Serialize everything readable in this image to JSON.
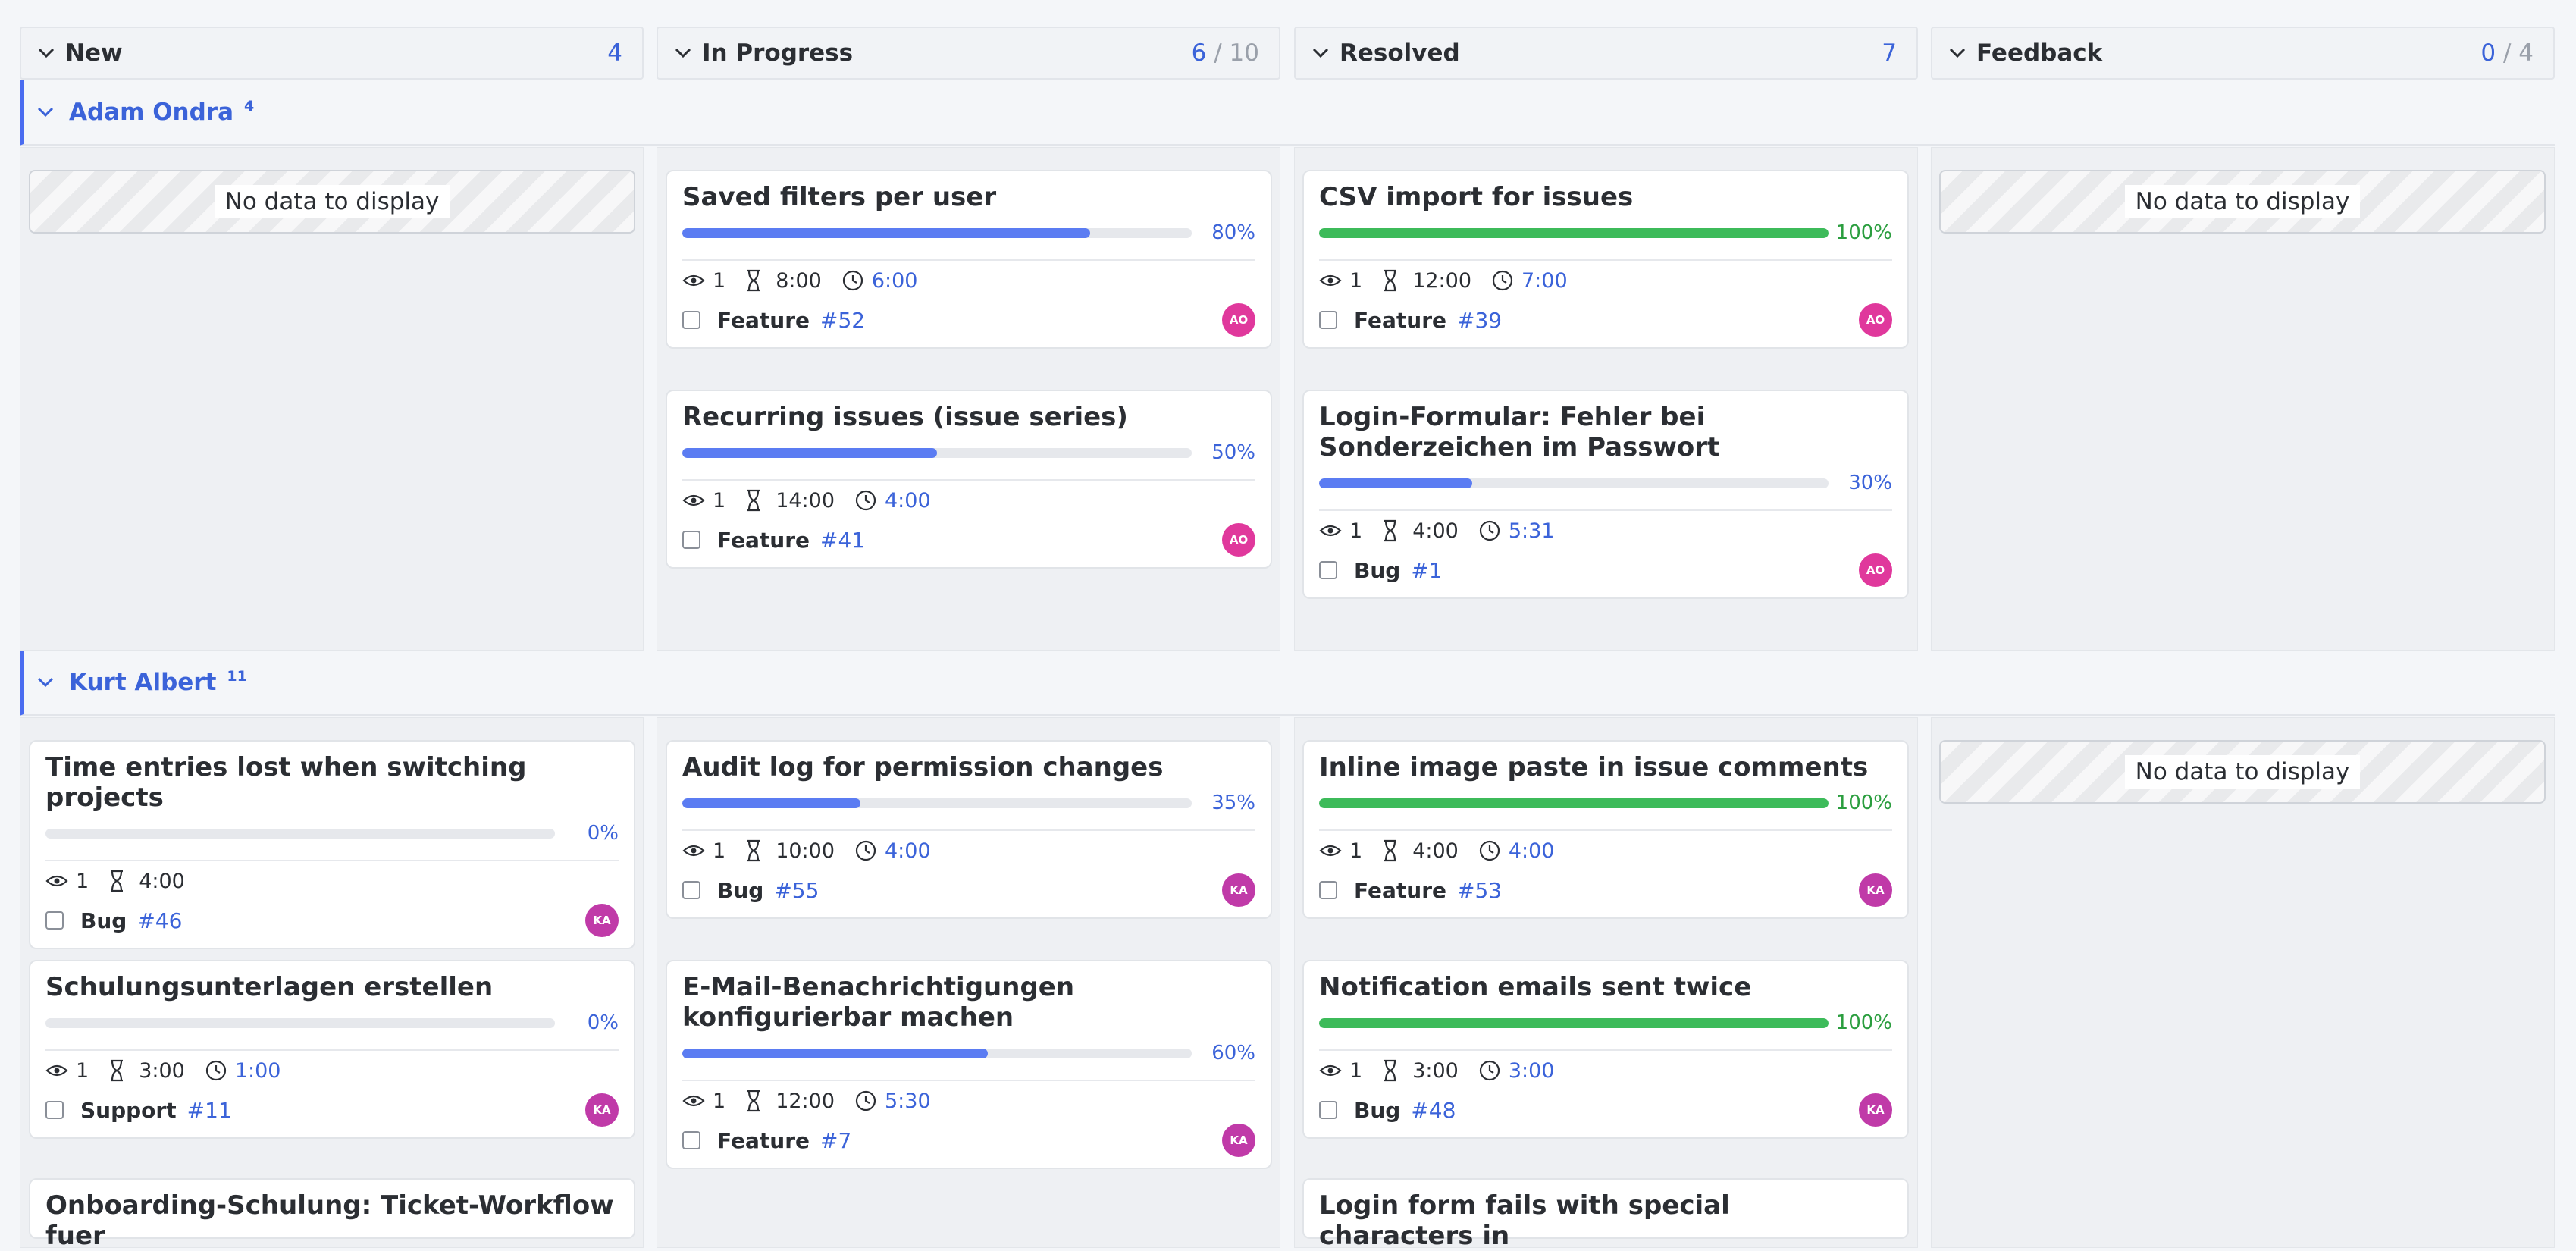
{
  "colors": {
    "accent": "#3b63d9",
    "progress_blue": "#5b7cf2",
    "progress_green": "#3dbb5a",
    "avatar_ao": "#e0389c",
    "avatar_ka": "#c03aa8"
  },
  "columns": [
    {
      "title": "New",
      "count": "4",
      "limit": ""
    },
    {
      "title": "In Progress",
      "count": "6",
      "limit": "10"
    },
    {
      "title": "Resolved",
      "count": "7",
      "limit": ""
    },
    {
      "title": "Feedback",
      "count": "0",
      "limit": "4"
    }
  ],
  "limit_separator": "/",
  "empty_text": "No data to display",
  "groups": [
    {
      "name": "Adam Ondra",
      "count": "4",
      "cards": {
        "in_progress": [
          {
            "subject": "Saved filters per user",
            "percent": 80,
            "percent_label": "80%",
            "watchers": "1",
            "estimated": "8:00",
            "spent": "6:00",
            "tracker": "Feature",
            "number": "#52",
            "avatar": "AO"
          },
          {
            "subject": "Recurring issues (issue series)",
            "percent": 50,
            "percent_label": "50%",
            "watchers": "1",
            "estimated": "14:00",
            "spent": "4:00",
            "tracker": "Feature",
            "number": "#41",
            "avatar": "AO"
          }
        ],
        "resolved": [
          {
            "subject": "CSV import for issues",
            "percent": 100,
            "percent_label": "100%",
            "watchers": "1",
            "estimated": "12:00",
            "spent": "7:00",
            "tracker": "Feature",
            "number": "#39",
            "avatar": "AO"
          },
          {
            "subject": "Login-Formular: Fehler bei Sonderzeichen im Passwort",
            "percent": 30,
            "percent_label": "30%",
            "watchers": "1",
            "estimated": "4:00",
            "spent": "5:31",
            "tracker": "Bug",
            "number": "#1",
            "avatar": "AO"
          }
        ]
      }
    },
    {
      "name": "Kurt Albert",
      "count": "11",
      "cards": {
        "new": [
          {
            "subject": "Time entries lost when switching projects",
            "percent": 0,
            "percent_label": "0%",
            "watchers": "1",
            "estimated": "4:00",
            "spent": "",
            "tracker": "Bug",
            "number": "#46",
            "avatar": "KA"
          },
          {
            "subject": "Schulungsunterlagen erstellen",
            "percent": 0,
            "percent_label": "0%",
            "watchers": "1",
            "estimated": "3:00",
            "spent": "1:00",
            "tracker": "Support",
            "number": "#11",
            "avatar": "KA"
          },
          {
            "subject": "Onboarding-Schulung: Ticket-Workflow fuer"
          }
        ],
        "in_progress": [
          {
            "subject": "Audit log for permission changes",
            "percent": 35,
            "percent_label": "35%",
            "watchers": "1",
            "estimated": "10:00",
            "spent": "4:00",
            "tracker": "Bug",
            "number": "#55",
            "avatar": "KA"
          },
          {
            "subject": "E-Mail-Benachrichtigungen konfigurierbar machen",
            "percent": 60,
            "percent_label": "60%",
            "watchers": "1",
            "estimated": "12:00",
            "spent": "5:30",
            "tracker": "Feature",
            "number": "#7",
            "avatar": "KA"
          }
        ],
        "resolved": [
          {
            "subject": "Inline image paste in issue comments",
            "percent": 100,
            "percent_label": "100%",
            "watchers": "1",
            "estimated": "4:00",
            "spent": "4:00",
            "tracker": "Feature",
            "number": "#53",
            "avatar": "KA"
          },
          {
            "subject": "Notification emails sent twice",
            "percent": 100,
            "percent_label": "100%",
            "watchers": "1",
            "estimated": "3:00",
            "spent": "3:00",
            "tracker": "Bug",
            "number": "#48",
            "avatar": "KA"
          },
          {
            "subject": "Login form fails with special characters in"
          }
        ]
      }
    }
  ]
}
